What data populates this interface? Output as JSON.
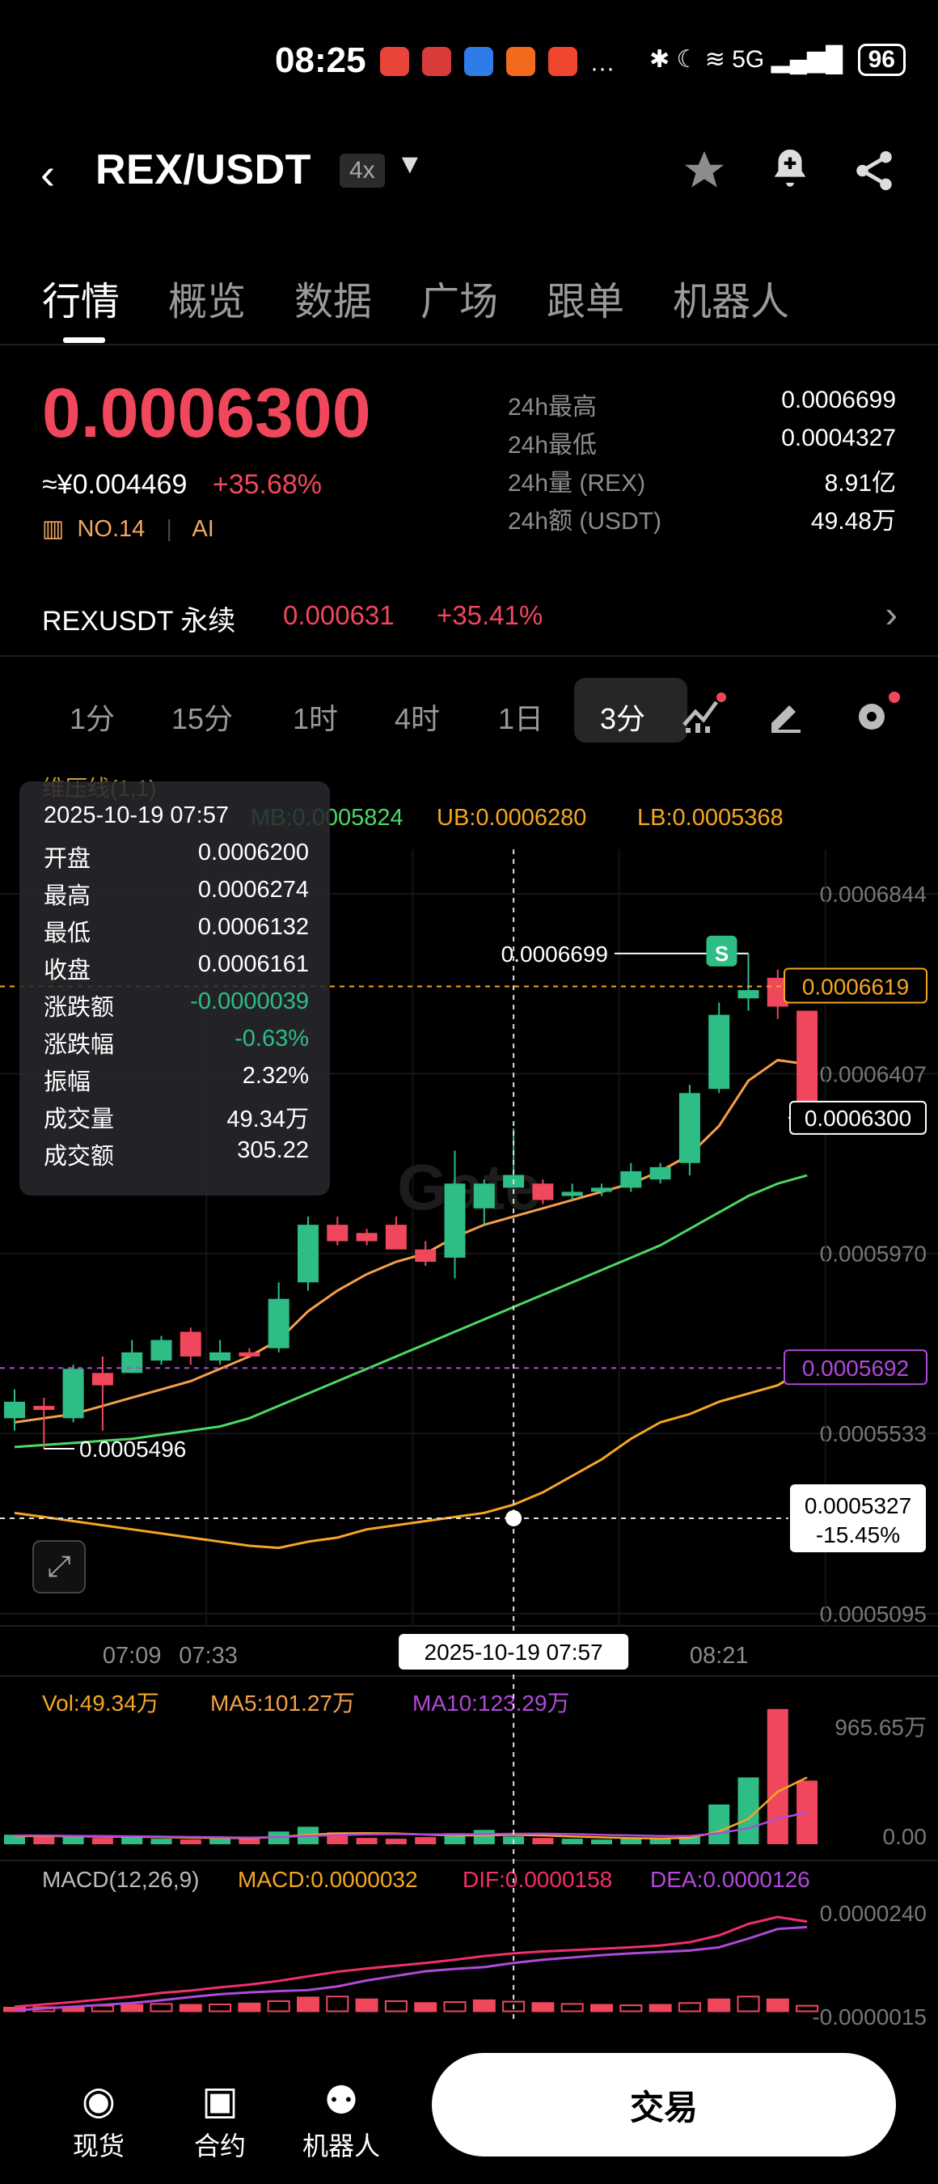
{
  "status_bar": {
    "time": "08:25",
    "network": "5G",
    "battery": "96"
  },
  "header": {
    "pair": "REX/USDT",
    "leverage": "4x"
  },
  "tabs": [
    "行情",
    "概览",
    "数据",
    "广场",
    "跟单",
    "机器人"
  ],
  "ticker": {
    "price": "0.0006300",
    "cny": "≈¥0.004469",
    "change": "+35.68%",
    "rank": "NO.14",
    "tag": "AI",
    "stats": [
      {
        "label": "24h最高",
        "value": "0.0006699"
      },
      {
        "label": "24h最低",
        "value": "0.0004327"
      },
      {
        "label": "24h量 (REX)",
        "value": "8.91亿"
      },
      {
        "label": "24h额 (USDT)",
        "value": "49.48万"
      }
    ]
  },
  "perp": {
    "name": "REXUSDT 永续",
    "price": "0.000631",
    "change": "+35.41%"
  },
  "timeframes": [
    "1分",
    "15分",
    "1时",
    "4时",
    "1日",
    "3分"
  ],
  "indicator_header": {
    "name": "维压线(1,1)",
    "mb": "MB:0.0005824",
    "ub": "UB:0.0006280",
    "lb": "LB:0.0005368"
  },
  "crosshair": {
    "datetime": "2025-10-19 07:57",
    "rows": [
      {
        "label": "开盘",
        "value": "0.0006200"
      },
      {
        "label": "最高",
        "value": "0.0006274"
      },
      {
        "label": "最低",
        "value": "0.0006132"
      },
      {
        "label": "收盘",
        "value": "0.0006161"
      },
      {
        "label": "涨跌额",
        "value": "-0.0000039"
      },
      {
        "label": "涨跌幅",
        "value": "-0.63%"
      },
      {
        "label": "振幅",
        "value": "2.32%"
      },
      {
        "label": "成交量",
        "value": "49.34万"
      },
      {
        "label": "成交额",
        "value": "305.22"
      }
    ],
    "y_label": "0.0005327",
    "y_pct": "-15.45%"
  },
  "chart_data": {
    "type": "candlestick",
    "y_ticks": [
      "0.0006844",
      "0.0006407",
      "0.0005970",
      "0.0005533",
      "0.0005095"
    ],
    "ylim": [
      0.0005095,
      0.0006844
    ],
    "x_labels": [
      "07:09",
      "07:33",
      "08:21"
    ],
    "max_label": "0.0006699",
    "min_label": "0.0005496",
    "last_price_label": "0.0006300",
    "line_labels": [
      "0.0006619",
      "0.0005692"
    ],
    "signal_marker": "S",
    "watermark": "Gate",
    "candles": [
      {
        "o": 0.000557,
        "c": 0.000561,
        "h": 0.000564,
        "l": 0.000554
      },
      {
        "o": 0.00056,
        "c": 0.000559,
        "h": 0.000562,
        "l": 0.0005496
      },
      {
        "o": 0.000557,
        "c": 0.000569,
        "h": 0.00057,
        "l": 0.000556
      },
      {
        "o": 0.000568,
        "c": 0.000565,
        "h": 0.000572,
        "l": 0.000554
      },
      {
        "o": 0.000568,
        "c": 0.000573,
        "h": 0.000576,
        "l": 0.000568
      },
      {
        "o": 0.000571,
        "c": 0.000576,
        "h": 0.000577,
        "l": 0.00057
      },
      {
        "o": 0.000578,
        "c": 0.000572,
        "h": 0.000579,
        "l": 0.00057
      },
      {
        "o": 0.000571,
        "c": 0.000573,
        "h": 0.000576,
        "l": 0.00057
      },
      {
        "o": 0.000573,
        "c": 0.000572,
        "h": 0.000574,
        "l": 0.000572
      },
      {
        "o": 0.000574,
        "c": 0.000586,
        "h": 0.00059,
        "l": 0.000573
      },
      {
        "o": 0.00059,
        "c": 0.000604,
        "h": 0.000606,
        "l": 0.000588
      },
      {
        "o": 0.000604,
        "c": 0.0006,
        "h": 0.000606,
        "l": 0.000599
      },
      {
        "o": 0.000602,
        "c": 0.0006,
        "h": 0.000603,
        "l": 0.000599
      },
      {
        "o": 0.000604,
        "c": 0.000598,
        "h": 0.000606,
        "l": 0.000598
      },
      {
        "o": 0.000598,
        "c": 0.000595,
        "h": 0.0006,
        "l": 0.000594
      },
      {
        "o": 0.000596,
        "c": 0.000614,
        "h": 0.000622,
        "l": 0.000591
      },
      {
        "o": 0.000608,
        "c": 0.000614,
        "h": 0.000615,
        "l": 0.000604
      },
      {
        "o": 0.000613,
        "c": 0.0006161,
        "h": 0.0006274,
        "l": 0.0006132
      },
      {
        "o": 0.000614,
        "c": 0.00061,
        "h": 0.000615,
        "l": 0.000609
      },
      {
        "o": 0.000611,
        "c": 0.000612,
        "h": 0.000614,
        "l": 0.00061
      },
      {
        "o": 0.000612,
        "c": 0.000613,
        "h": 0.000614,
        "l": 0.000611
      },
      {
        "o": 0.000613,
        "c": 0.000617,
        "h": 0.000619,
        "l": 0.000612
      },
      {
        "o": 0.000615,
        "c": 0.000618,
        "h": 0.000619,
        "l": 0.000614
      },
      {
        "o": 0.000619,
        "c": 0.000636,
        "h": 0.000638,
        "l": 0.000616
      },
      {
        "o": 0.000637,
        "c": 0.000655,
        "h": 0.000658,
        "l": 0.000636
      },
      {
        "o": 0.000659,
        "c": 0.000661,
        "h": 0.0006699,
        "l": 0.000656
      },
      {
        "o": 0.000664,
        "c": 0.000657,
        "h": 0.000666,
        "l": 0.000654
      },
      {
        "o": 0.000656,
        "c": 0.00063,
        "h": 0.000656,
        "l": 0.00063
      }
    ],
    "bands": {
      "ub": [
        0.000556,
        0.000557,
        0.000558,
        0.00056,
        0.000562,
        0.000564,
        0.000566,
        0.000569,
        0.000572,
        0.000576,
        0.000583,
        0.000588,
        0.000592,
        0.000595,
        0.000597,
        0.000601,
        0.000604,
        0.000606,
        0.000608,
        0.00061,
        0.000612,
        0.000614,
        0.000617,
        0.000621,
        0.000628,
        0.000639,
        0.000644,
        0.000643
      ],
      "mb": [
        0.00055,
        0.0005505,
        0.000551,
        0.0005515,
        0.000552,
        0.000553,
        0.000554,
        0.000555,
        0.000557,
        0.00056,
        0.000563,
        0.000566,
        0.000569,
        0.000572,
        0.000575,
        0.000578,
        0.000581,
        0.000584,
        0.000587,
        0.00059,
        0.000593,
        0.000596,
        0.000599,
        0.000603,
        0.000607,
        0.000611,
        0.000614,
        0.000616
      ],
      "lb": [
        0.000534,
        0.000533,
        0.000532,
        0.000531,
        0.00053,
        0.000529,
        0.000528,
        0.000527,
        0.000526,
        0.0005255,
        0.000527,
        0.000528,
        0.00053,
        0.000531,
        0.000532,
        0.000533,
        0.000534,
        0.000536,
        0.000539,
        0.000543,
        0.000547,
        0.000552,
        0.000556,
        0.000558,
        0.000561,
        0.000563,
        0.000565,
        0.0005692
      ]
    },
    "volume": {
      "header": {
        "vol": "Vol:49.34万",
        "ma5": "MA5:101.27万",
        "ma10": "MA10:123.29万"
      },
      "y_ticks": [
        "965.65万",
        "0.00"
      ],
      "max": 965.65,
      "values": [
        60,
        50,
        55,
        40,
        45,
        35,
        30,
        40,
        35,
        80,
        110,
        75,
        40,
        35,
        45,
        70,
        90,
        49.34,
        40,
        35,
        30,
        40,
        35,
        55,
        250,
        420,
        850,
        400
      ],
      "ma5": [
        50,
        52,
        50,
        48,
        47,
        45,
        41,
        40,
        38,
        46,
        60,
        68,
        70,
        68,
        61,
        55,
        56,
        59,
        55,
        49,
        43,
        39,
        36,
        40,
        80,
        160,
        330,
        420
      ],
      "ma10": [
        55,
        55,
        53,
        52,
        50,
        48,
        46,
        44,
        42,
        45,
        52,
        58,
        62,
        64,
        62,
        62,
        64,
        66,
        67,
        64,
        59,
        56,
        52,
        52,
        70,
        100,
        160,
        200
      ]
    },
    "macd": {
      "header": {
        "title": "MACD(12,26,9)",
        "macd": "MACD:0.0000032",
        "dif": "DIF:0.0000158",
        "dea": "DEA:0.0000126"
      },
      "y_ticks": [
        "0.0000240",
        "-0.0000015"
      ],
      "ylim": [
        -1.5e-06,
        2.4e-05
      ],
      "hist": [
        8e-07,
        9e-07,
        1e-06,
        1.2e-06,
        1.4e-06,
        1.6e-06,
        1.4e-06,
        1.5e-06,
        1.7e-06,
        2.2e-06,
        3e-06,
        3.2e-06,
        2.6e-06,
        2.2e-06,
        1.8e-06,
        2e-06,
        2.4e-06,
        2.1e-06,
        1.8e-06,
        1.6e-06,
        1.4e-06,
        1.3e-06,
        1.4e-06,
        1.8e-06,
        2.6e-06,
        3.2e-06,
        2.6e-06,
        1.2e-06
      ],
      "dif": [
        1e-06,
        1.5e-06,
        2e-06,
        2.6e-06,
        3.2e-06,
        4e-06,
        4.5e-06,
        5.2e-06,
        5.8e-06,
        6.6e-06,
        7.6e-06,
        8.6e-06,
        9.3e-06,
        9.9e-06,
        1.05e-05,
        1.12e-05,
        1.2e-05,
        1.26e-05,
        1.3e-05,
        1.33e-05,
        1.36e-05,
        1.39e-05,
        1.43e-05,
        1.5e-05,
        1.65e-05,
        1.9e-05,
        2.05e-05,
        1.95e-05
      ],
      "dea": [
        2e-07,
        6e-07,
        1e-06,
        1.4e-06,
        1.8e-06,
        2.4e-06,
        3.1e-06,
        3.7e-06,
        4.1e-06,
        4.4e-06,
        4.6e-06,
        5.4e-06,
        6.7e-06,
        7.7e-06,
        8.7e-06,
        9.2e-06,
        9.6e-06,
        1.05e-05,
        1.12e-05,
        1.17e-05,
        1.22e-05,
        1.26e-05,
        1.29e-05,
        1.32e-05,
        1.39e-05,
        1.58e-05,
        1.79e-05,
        1.83e-05
      ]
    }
  },
  "bottom_nav": {
    "spot": "现货",
    "contract": "合约",
    "bot": "机器人",
    "trade": "交易"
  }
}
